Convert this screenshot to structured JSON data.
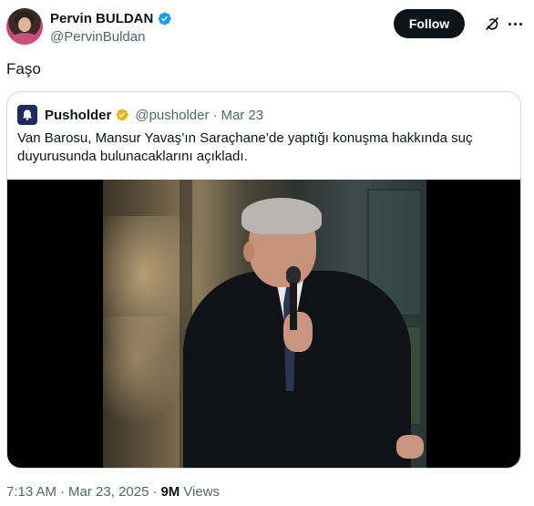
{
  "author": {
    "display_name": "Pervin BULDAN",
    "handle": "@PervinBuldan",
    "verified_color": "#1d9bf0"
  },
  "actions": {
    "follow_label": "Follow",
    "grok_icon": "grok-icon",
    "more_icon": "more-icon"
  },
  "tweet": {
    "text": "Faşo"
  },
  "quoted": {
    "display_name": "Pusholder",
    "handle": "@pusholder",
    "separator": "·",
    "date": "Mar 23",
    "verified_color": "#e2b719",
    "text": "Van Barosu, Mansur Yavaş’ın Saraçhane’de yaptığı konuşma hakkında suç duyurusunda bulunacaklarını açıkladı."
  },
  "meta": {
    "time": "7:13 AM",
    "separator": "·",
    "date": "Mar 23, 2025",
    "separator2": "·",
    "views_count": "9M",
    "views_label": "Views"
  }
}
